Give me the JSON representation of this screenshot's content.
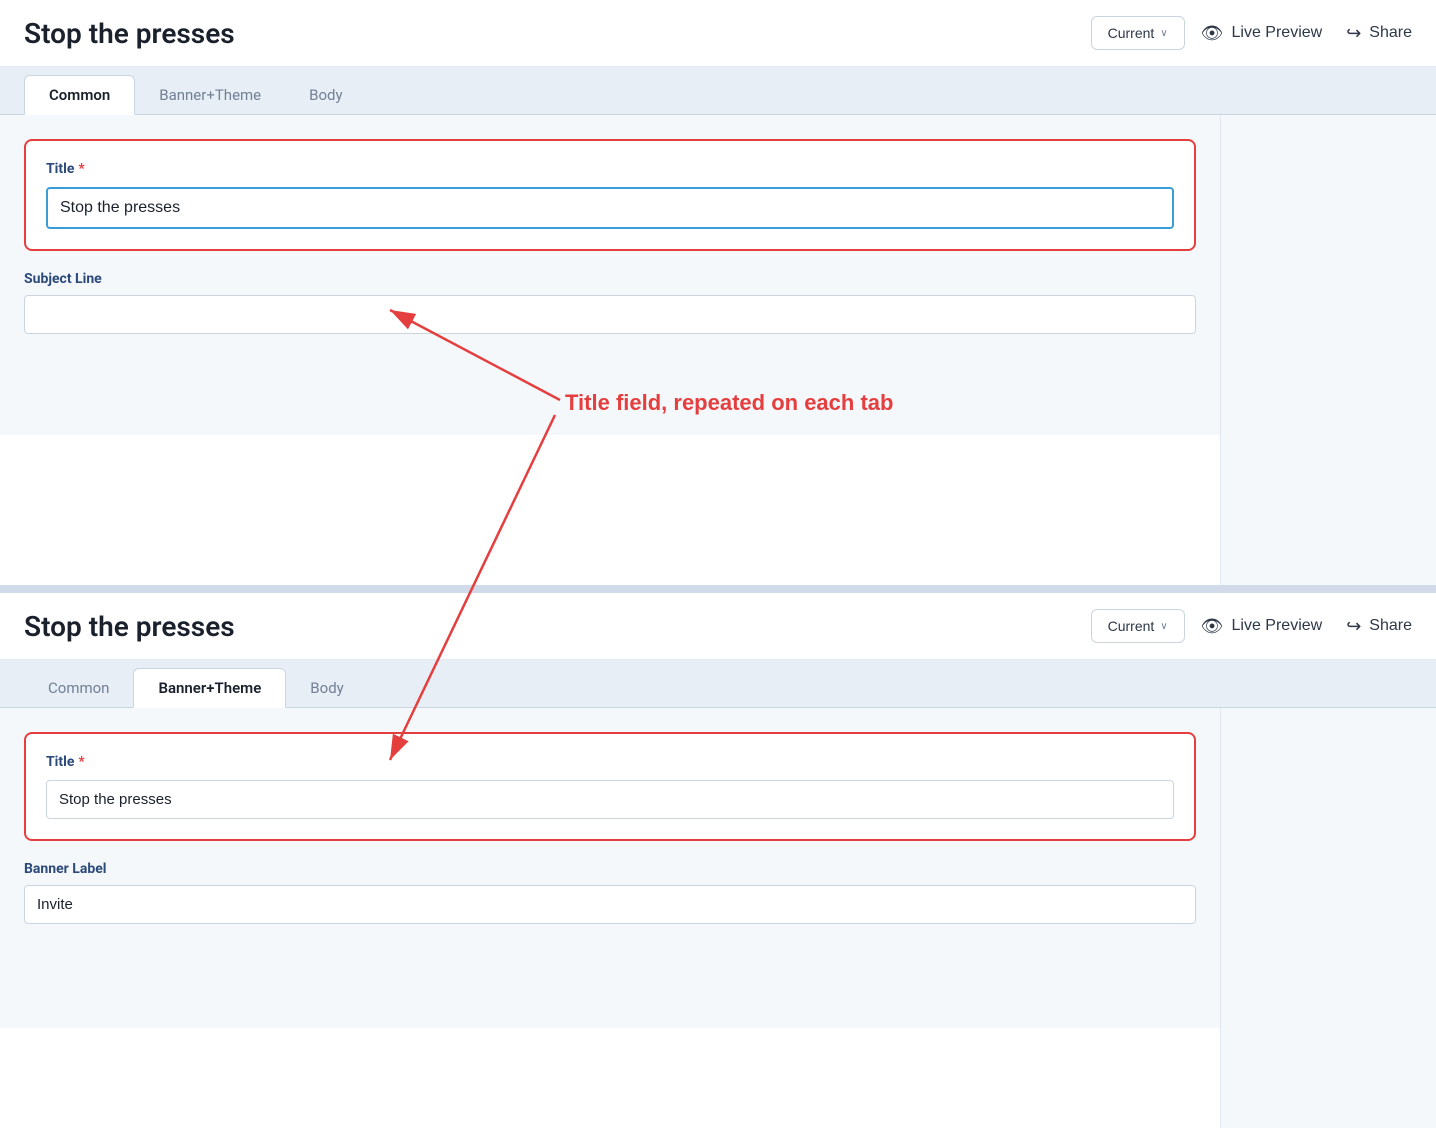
{
  "top": {
    "title": "Stop the presses",
    "dropdown": {
      "label": "Current",
      "chevron": "∨"
    },
    "livePreview": "Live Preview",
    "share": "Share",
    "tabs": [
      {
        "label": "Common",
        "active": true
      },
      {
        "label": "Banner+Theme",
        "active": false
      },
      {
        "label": "Body",
        "active": false
      }
    ],
    "titleField": {
      "label": "Title",
      "required": true,
      "value": "Stop the presses"
    },
    "subjectField": {
      "label": "Subject Line",
      "value": ""
    }
  },
  "annotation": {
    "text": "Title field, repeated on each tab"
  },
  "bottom": {
    "title": "Stop the presses",
    "dropdown": {
      "label": "Current",
      "chevron": "∨"
    },
    "livePreview": "Live Preview",
    "share": "Share",
    "tabs": [
      {
        "label": "Common",
        "active": false
      },
      {
        "label": "Banner+Theme",
        "active": true
      },
      {
        "label": "Body",
        "active": false
      }
    ],
    "titleField": {
      "label": "Title",
      "required": true,
      "value": "Stop the presses"
    },
    "bannerField": {
      "label": "Banner Label",
      "value": "Invite"
    }
  }
}
